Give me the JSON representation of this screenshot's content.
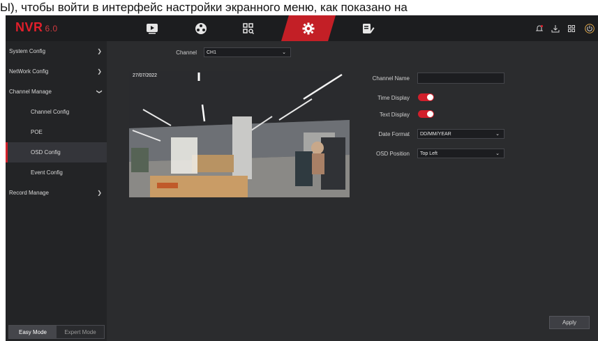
{
  "caption": "Ы), чтобы войти в интерфейс настройки экранного меню, как показано на",
  "app": {
    "logo": "NVR",
    "version": "6.0"
  },
  "nav": {
    "tabs": [
      {
        "name": "playback",
        "icon": "play-icon"
      },
      {
        "name": "ai",
        "icon": "ai-face-icon"
      },
      {
        "name": "search",
        "icon": "search-icon"
      },
      {
        "name": "settings",
        "icon": "gear-icon",
        "active": true
      },
      {
        "name": "maintenance",
        "icon": "edit-icon"
      }
    ],
    "right_icons": [
      "alarm-bell-icon",
      "backup-icon",
      "grid-icon",
      "power-icon"
    ]
  },
  "sidebar": {
    "items": [
      {
        "label": "System Config",
        "has_chevron": true,
        "expanded": false
      },
      {
        "label": "NetWork Config",
        "has_chevron": true,
        "expanded": false
      },
      {
        "label": "Channel Manage",
        "has_chevron": true,
        "expanded": true
      },
      {
        "label": "Channel Config",
        "sub": true
      },
      {
        "label": "POE",
        "sub": true
      },
      {
        "label": "OSD Config",
        "sub": true,
        "active": true
      },
      {
        "label": "Event Config",
        "sub": true
      },
      {
        "label": "Record Manage",
        "has_chevron": true,
        "expanded": false
      }
    ],
    "mode": {
      "easy": "Easy Mode",
      "expert": "Expert Mode",
      "selected": "easy"
    }
  },
  "form": {
    "channel_label": "Channel",
    "channel_value": "CH1",
    "channel_name_label": "Channel Name",
    "channel_name_value": "",
    "time_display_label": "Time Display",
    "time_display_on": true,
    "text_display_label": "Text Display",
    "text_display_on": true,
    "date_format_label": "Date Format",
    "date_format_value": "DD/MM/YEAR",
    "osd_position_label": "OSD Position",
    "osd_position_value": "Top Left"
  },
  "preview": {
    "timestamp": "27/07/2022"
  },
  "buttons": {
    "apply": "Apply"
  },
  "colors": {
    "accent": "#d11f2b",
    "background": "#2b2c2e",
    "sidebar": "#232426",
    "topbar": "#1c1d1f"
  }
}
